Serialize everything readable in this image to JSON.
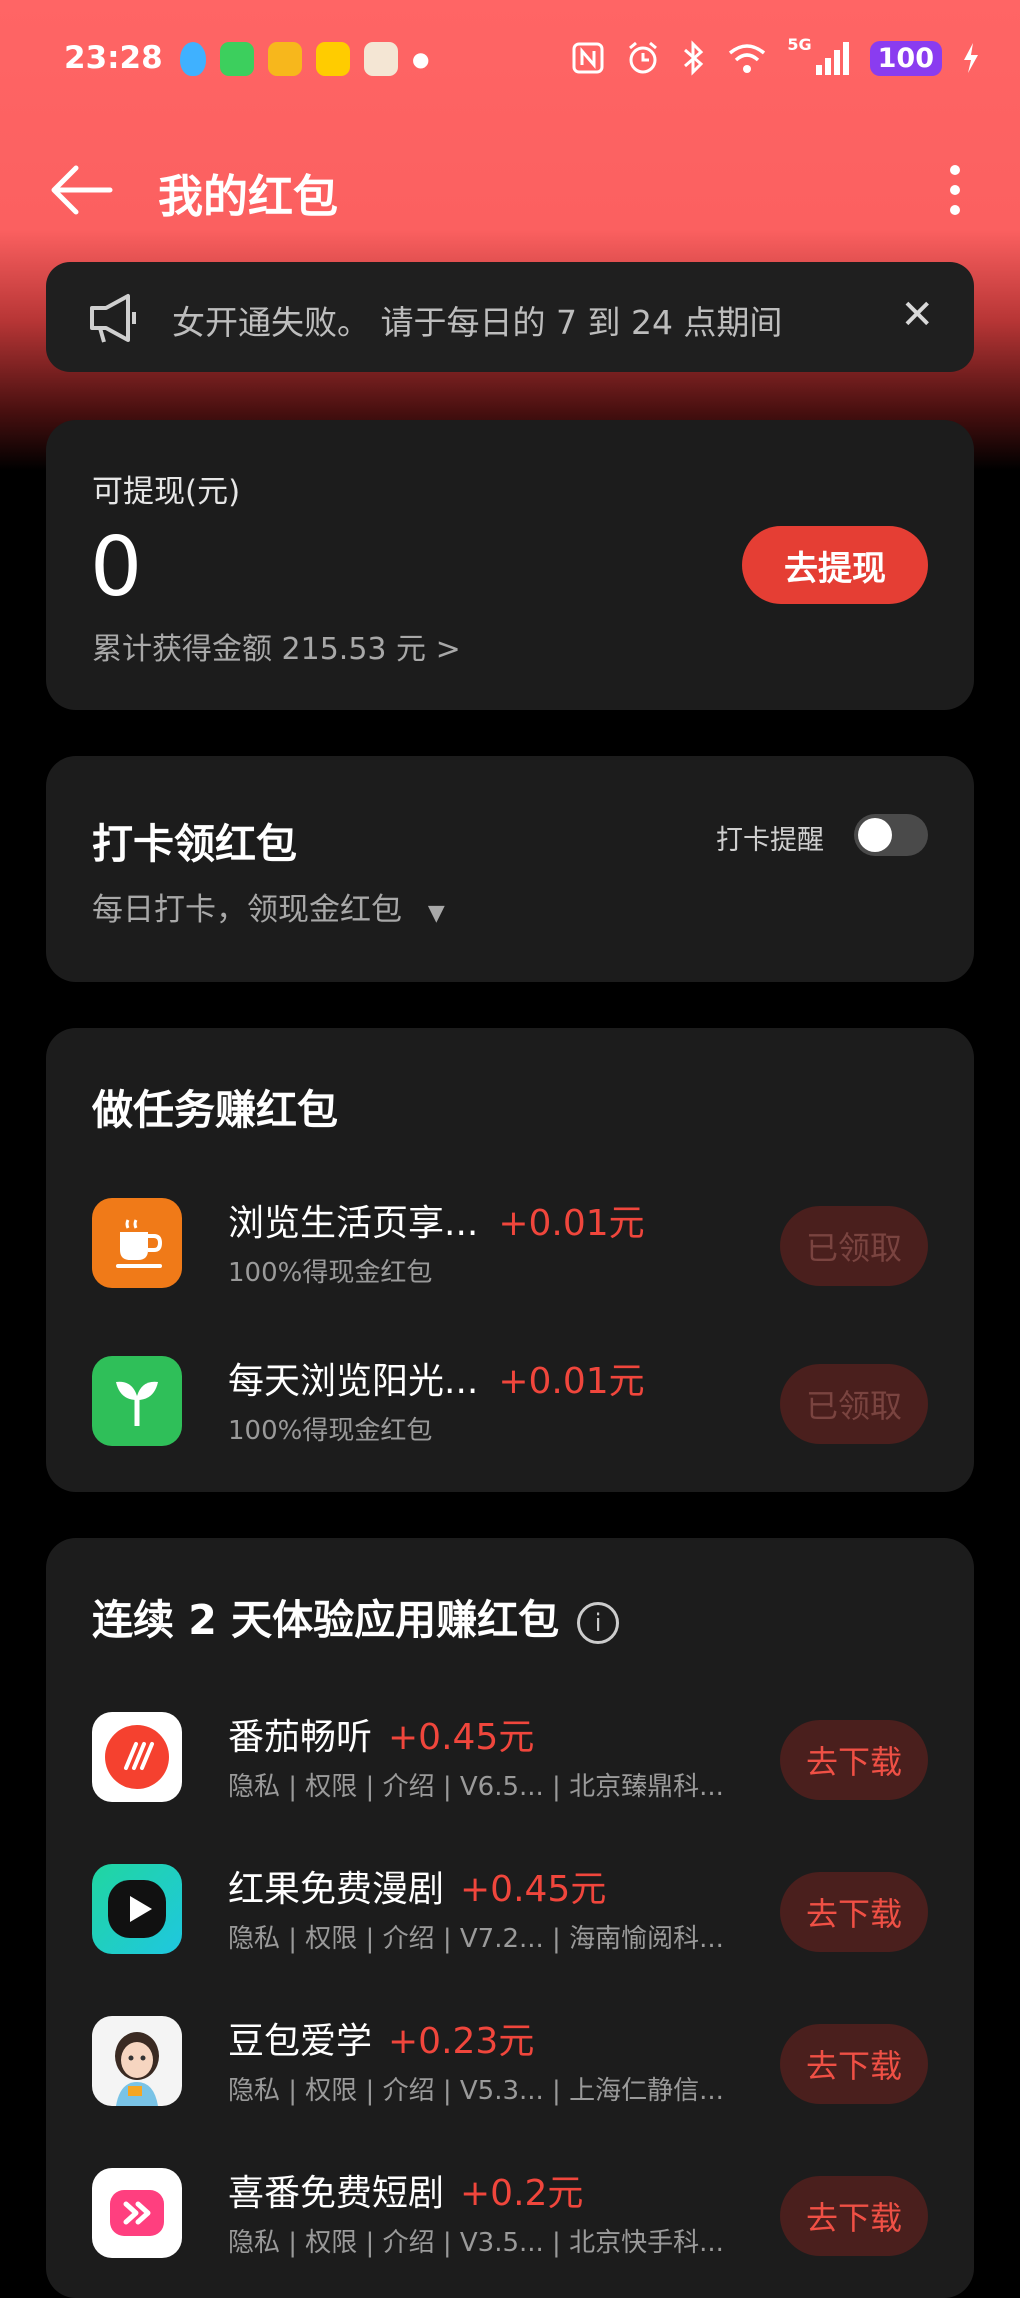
{
  "status_bar": {
    "time": "23:28",
    "battery": "100",
    "network": "5G",
    "icons": [
      "nfc-icon",
      "alarm-icon",
      "bluetooth-icon",
      "wifi-icon",
      "signal-icon",
      "charging-icon"
    ]
  },
  "header": {
    "title": "我的红包"
  },
  "notice": {
    "text": "女开通失败。  请于每日的 7 到 24 点期间"
  },
  "withdraw": {
    "label": "可提现(元)",
    "amount": "0",
    "total": "累计获得金额 215.53 元",
    "button": "去提现"
  },
  "checkin": {
    "title": "打卡领红包",
    "subtitle": "每日打卡，领现金红包",
    "reminder_label": "打卡提醒",
    "reminder_on": false
  },
  "tasks": {
    "title": "做任务赚红包",
    "items": [
      {
        "title": "浏览生活页享...",
        "reward": "+0.01元",
        "subtitle": "100%得现金红包",
        "button": "已领取",
        "icon": "coffee-cup-icon",
        "color": "#f07a18"
      },
      {
        "title": "每天浏览阳光...",
        "reward": "+0.01元",
        "subtitle": "100%得现金红包",
        "button": "已领取",
        "icon": "sprout-icon",
        "color": "#2fbf59"
      }
    ]
  },
  "apps": {
    "title": "连续 2 天体验应用赚红包",
    "items": [
      {
        "title": "番茄畅听",
        "reward": "+0.45元",
        "subtitle": "隐私 | 权限 | 介绍 | V6.5... | 北京臻鼎科...",
        "button": "去下载",
        "icon": "fanqie-app-icon",
        "color": "#f5412f"
      },
      {
        "title": "红果免费漫剧",
        "reward": "+0.45元",
        "subtitle": "隐私 | 权限 | 介绍 | V7.2... | 海南愉阅科...",
        "button": "去下载",
        "icon": "hongguo-app-icon",
        "color": "#20d6a0"
      },
      {
        "title": "豆包爱学",
        "reward": "+0.23元",
        "subtitle": "隐私 | 权限 | 介绍 | V5.3... | 上海仁静信...",
        "button": "去下载",
        "icon": "doubao-app-icon",
        "color": "#7ec8e3"
      },
      {
        "title": "喜番免费短剧",
        "reward": "+0.2元",
        "subtitle": "隐私 | 权限 | 介绍 | V3.5... | 北京快手科...",
        "button": "去下载",
        "icon": "xifan-app-icon",
        "color": "#ff3f7f"
      }
    ]
  }
}
